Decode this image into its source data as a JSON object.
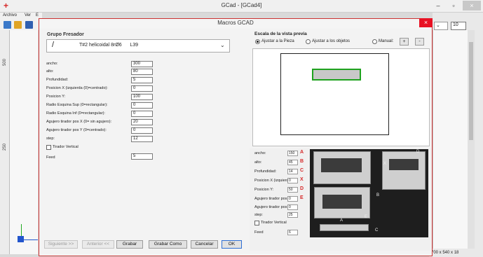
{
  "main_window": {
    "title": "GCad - [GCad4]",
    "menu": [
      "Archivo",
      "Ver",
      "E"
    ],
    "ruler_numbers": [
      "500",
      "250"
    ],
    "zoom_value": "10",
    "status_size": "700 x 540 x 18"
  },
  "dialog": {
    "title": "Macros GCAD",
    "close_glyph": "×",
    "group_label": "Grupo Fresador",
    "tool": {
      "prefix": "/",
      "name": "T#2 helicoidal 8rØ6",
      "code": "L39"
    },
    "params": [
      {
        "label": "ancho:",
        "value": "300"
      },
      {
        "label": "alto:",
        "value": "80"
      },
      {
        "label": "Profundidad:",
        "value": "5"
      },
      {
        "label": "Posicion X (izquierda (0)=centrado):",
        "value": "0"
      },
      {
        "label": "Posicion Y:",
        "value": "100"
      },
      {
        "label": "Radio Esquina Sup (0=rectangular):",
        "value": "0"
      },
      {
        "label": "Radio Esquina Inf (0=rectangular):",
        "value": "0"
      },
      {
        "label": "Agujero tirador pos X (0= sin agujero):",
        "value": "20"
      },
      {
        "label": "Agujero tirador pos Y (0=centrado):",
        "value": "0"
      },
      {
        "label": "step:",
        "value": "12"
      }
    ],
    "vertical_label": "Tirador Vertical",
    "feed_label": "Feed",
    "feed_value": "5",
    "scale": {
      "label": "Escala de la vista previa",
      "options": [
        "Ajustar a la Pieza",
        "Ajustar a los objetos",
        "Manual:"
      ],
      "selected": 0,
      "plus": "+",
      "minus": "-"
    },
    "preview_params": [
      {
        "label": "ancho:",
        "value": "150",
        "letter": "A"
      },
      {
        "label": "alto:",
        "value": "45",
        "letter": "B"
      },
      {
        "label": "Profundidad:",
        "value": "14",
        "letter": "C"
      },
      {
        "label": "Posicion X (izquierda",
        "value": "0",
        "letter": "X"
      },
      {
        "label": "Posicion Y:",
        "value": "50",
        "letter": "D"
      },
      {
        "label": "Agujero tirador pos X",
        "value": "0",
        "letter": "E"
      },
      {
        "label": "Agujero tirador pos Y",
        "value": "0",
        "letter": ""
      },
      {
        "label": "step:",
        "value": "25",
        "letter": ""
      }
    ],
    "preview_vertical_label": "Tirador Vertical",
    "preview_feed_label": "Feed",
    "preview_feed_value": "6",
    "photo_labels": [
      "D",
      "X",
      "B",
      "E",
      "A",
      "C"
    ],
    "buttons": {
      "next": "Siguiente >>",
      "prev": "Anterior <<",
      "save": "Grabar",
      "save_as": "Grabar Como",
      "cancel": "Cancelar",
      "ok": "OK"
    }
  }
}
